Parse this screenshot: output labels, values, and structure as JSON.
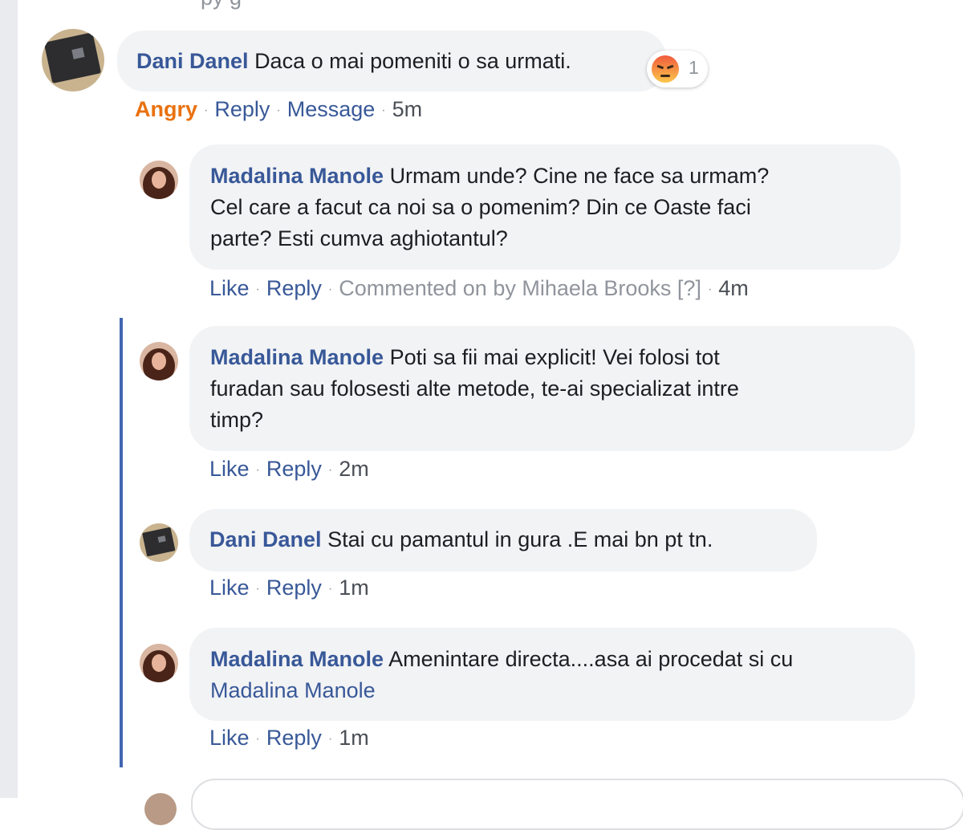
{
  "top_fragment": "py  g",
  "comments": [
    {
      "author": "Dani Danel",
      "text": "Daca o mai pomeniti o sa urmati.",
      "reaction": {
        "icon": "angry-emoji-icon",
        "count": "1"
      },
      "actions": {
        "reaction_label": "Angry",
        "reply": "Reply",
        "message": "Message",
        "time": "5m"
      }
    },
    {
      "author": "Madalina Manole",
      "text_lines": [
        "Urmam unde? Cine ne face sa urmam?",
        "Cel care a facut ca noi sa o pomenim? Din ce Oaste faci",
        "parte? Esti cumva aghiotantul?"
      ],
      "actions": {
        "like": "Like",
        "reply": "Reply",
        "commented_on": "Commented on by Mihaela Brooks [?]",
        "time": "4m"
      }
    },
    {
      "author": "Madalina Manole",
      "text_lines": [
        "Poti sa fii mai explicit! Vei folosi tot",
        "furadan sau folosesti alte metode, te-ai specializat intre",
        "timp?"
      ],
      "actions": {
        "like": "Like",
        "reply": "Reply",
        "time": "2m"
      }
    },
    {
      "author": "Dani Danel",
      "text": "Stai cu pamantul in gura .E mai bn pt tn.",
      "actions": {
        "like": "Like",
        "reply": "Reply",
        "time": "1m"
      }
    },
    {
      "author": "Madalina Manole",
      "text": "Amenintare directa....asa ai procedat si cu",
      "mention": "Madalina Manole",
      "actions": {
        "like": "Like",
        "reply": "Reply",
        "time": "1m"
      }
    }
  ],
  "colors": {
    "link": "#385898",
    "bubble": "#f2f3f5",
    "thread_line": "#4267b2",
    "angry": "#e9710f"
  }
}
